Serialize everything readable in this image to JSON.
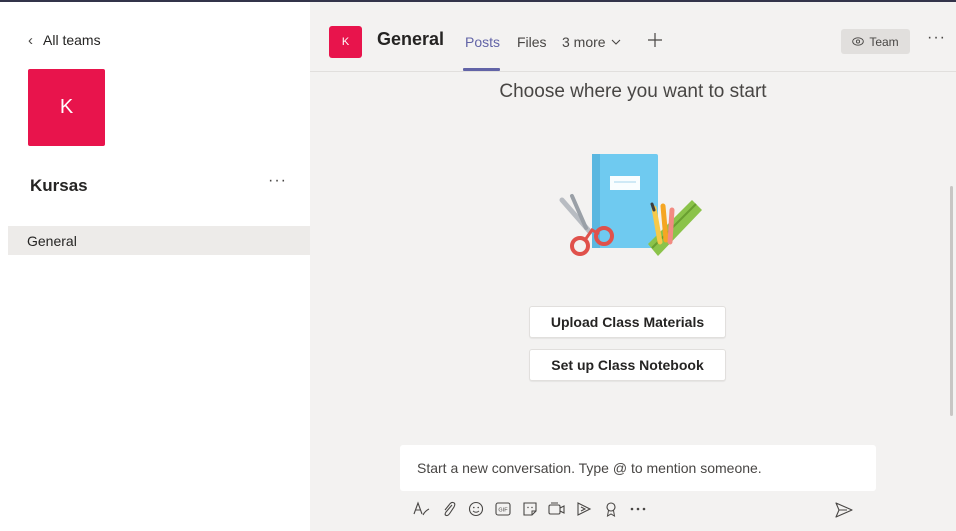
{
  "sidebar": {
    "back_label": "All teams",
    "team_initial": "K",
    "team_name": "Kursas",
    "more_label": "···",
    "channels": [
      {
        "label": "General"
      }
    ]
  },
  "header": {
    "channel_initial": "K",
    "channel_name": "General",
    "tabs": [
      {
        "label": "Posts",
        "active": true
      },
      {
        "label": "Files"
      },
      {
        "label": "3 more"
      }
    ],
    "add_tab_icon": "plus-icon",
    "team_button_label": "Team",
    "more_label": "···"
  },
  "main": {
    "title": "Choose where you want to start",
    "illustration_icon": "notebook-scissors-pencils-illustration",
    "buttons": [
      {
        "label": "Upload Class Materials"
      },
      {
        "label": "Set up Class Notebook"
      }
    ]
  },
  "compose": {
    "placeholder": "Start a new conversation. Type @ to mention someone.",
    "toolbar_icons": [
      "format-icon",
      "attach-icon",
      "emoji-icon",
      "gif-icon",
      "sticker-icon",
      "meet-now-icon",
      "stream-icon",
      "praise-icon",
      "more-options-icon"
    ],
    "send_icon": "send-icon"
  },
  "colors": {
    "accent": "#6264a7",
    "team_tile": "#e8144c",
    "background": "#f3f2f1"
  }
}
